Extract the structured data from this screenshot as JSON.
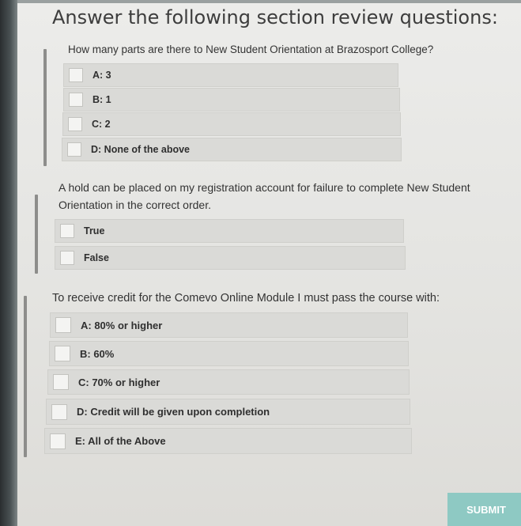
{
  "heading": "Answer the following section review questions:",
  "questions": [
    {
      "text": "How many parts are there to New Student Orientation at Brazosport College?",
      "options": [
        "A: 3",
        "B: 1",
        "C: 2",
        "D: None of the above"
      ]
    },
    {
      "text": "A hold can be placed on my registration account for failure to complete New Student Orientation in the correct order.",
      "options": [
        "True",
        "False"
      ]
    },
    {
      "text": "To receive credit for the Comevo Online Module I must pass the course with:",
      "options": [
        "A: 80% or higher",
        "B: 60%",
        "C: 70% or higher",
        "D: Credit will be given upon completion",
        "E: All of the Above"
      ]
    }
  ],
  "submit_label": "SUBMIT",
  "colors": {
    "submit_bg": "#8ec9c3",
    "option_bg": "#dadad7",
    "text": "#333333"
  }
}
